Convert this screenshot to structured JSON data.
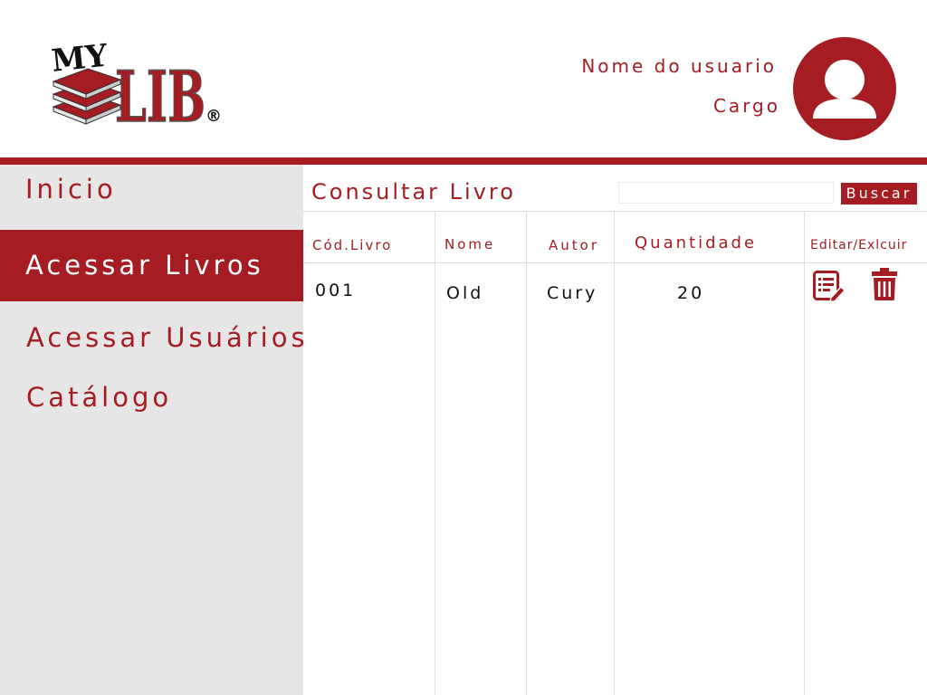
{
  "header": {
    "logo": {
      "text_top": "MY",
      "text_main": "LIB",
      "mark": "®"
    },
    "user_name": "Nome do usuario",
    "user_role": "Cargo",
    "avatar_icon": "user-avatar-icon"
  },
  "sidebar": {
    "items": [
      {
        "label": "Inicio",
        "active": false
      },
      {
        "label": "Acessar Livros",
        "active": true
      },
      {
        "label": "Acessar Usuários",
        "active": false
      },
      {
        "label": "Catálogo",
        "active": false
      }
    ]
  },
  "main": {
    "title": "Consultar Livro",
    "search": {
      "value": "",
      "placeholder": "",
      "button_label": "Buscar"
    },
    "table": {
      "columns": [
        "Cód.Livro",
        "Nome",
        "Autor",
        "Quantidade",
        "Editar/Exlcuir"
      ],
      "rows": [
        {
          "codigo": "001",
          "nome": "Old",
          "autor": "Cury",
          "quantidade": "20",
          "actions": [
            "edit-icon",
            "trash-icon"
          ]
        }
      ]
    }
  },
  "colors": {
    "accent": "#a51c22",
    "sidebar_bg": "#e6e6e6",
    "grid_line": "#dedede"
  }
}
